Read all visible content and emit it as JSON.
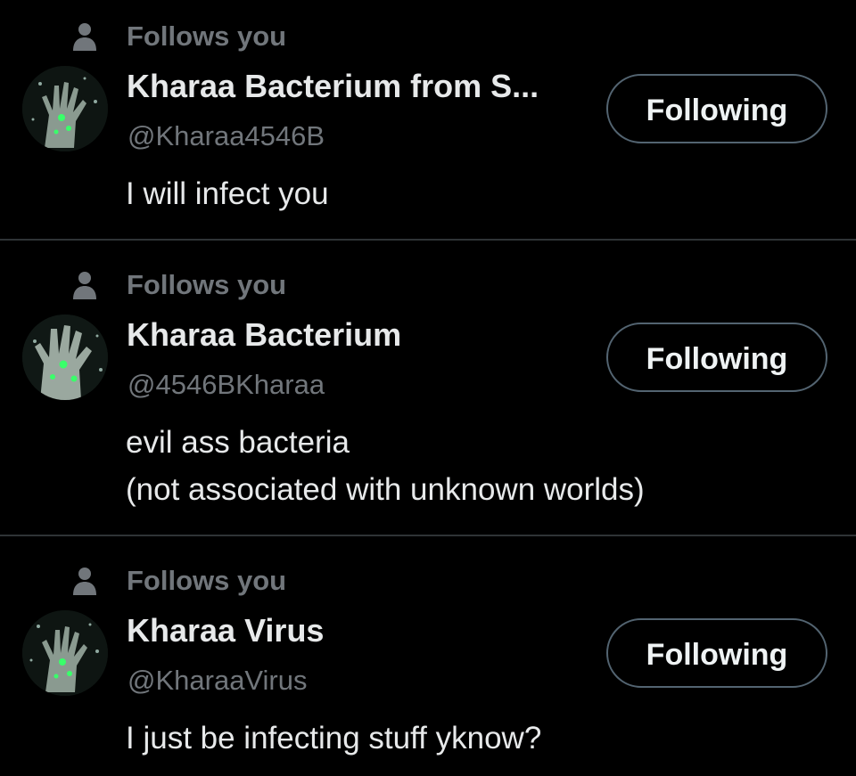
{
  "colors": {
    "background": "#000000",
    "primary_text": "#e7e9ea",
    "secondary_text": "#71767b",
    "divider": "#2f3336",
    "button_border": "#536471",
    "avatar_glow": "#39ff6a"
  },
  "users": [
    {
      "follows_label": "Follows you",
      "follows_icon": "person-icon",
      "display_name": "Kharaa Bacterium from S...",
      "handle": "@Kharaa4546B",
      "button_label": "Following",
      "bio_lines": [
        "I will infect you"
      ]
    },
    {
      "follows_label": "Follows you",
      "follows_icon": "person-icon",
      "display_name": "Kharaa Bacterium",
      "handle": "@4546BKharaa",
      "button_label": "Following",
      "bio_lines": [
        "evil ass bacteria",
        "(not associated with unknown worlds)"
      ]
    },
    {
      "follows_label": "Follows you",
      "follows_icon": "person-icon",
      "display_name": "Kharaa Virus",
      "handle": "@KharaaVirus",
      "button_label": "Following",
      "bio_lines": [
        "I just be infecting stuff yknow?"
      ]
    }
  ]
}
